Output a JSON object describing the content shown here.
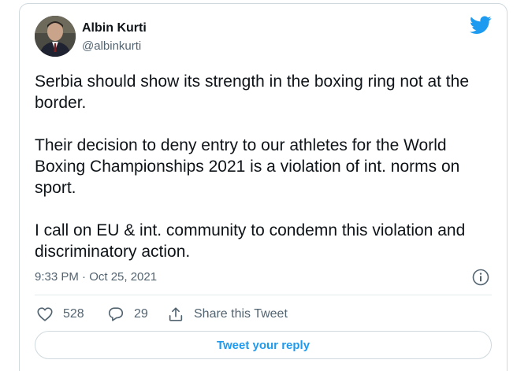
{
  "author": {
    "display_name": "Albin Kurti",
    "handle": "@albinkurti"
  },
  "tweet": {
    "paragraphs": [
      "Serbia should show its strength in the boxing ring not at the border.",
      "Their decision to deny entry to our athletes for the World Boxing Championships 2021 is a violation of int. norms on sport.",
      "I call on EU & int. community to condemn this violation and discriminatory action."
    ],
    "timestamp": "9:33 PM · Oct 25, 2021"
  },
  "actions": {
    "likes": "528",
    "replies": "29",
    "share_label": "Share this Tweet",
    "reply_button_label": "Tweet your reply"
  },
  "colors": {
    "accent": "#1d9bf0",
    "text_primary": "#0f1419",
    "text_secondary": "#536471",
    "border": "#cfd9de"
  },
  "icons": [
    "twitter-bird-icon",
    "info-icon",
    "heart-icon",
    "reply-icon",
    "share-icon"
  ]
}
